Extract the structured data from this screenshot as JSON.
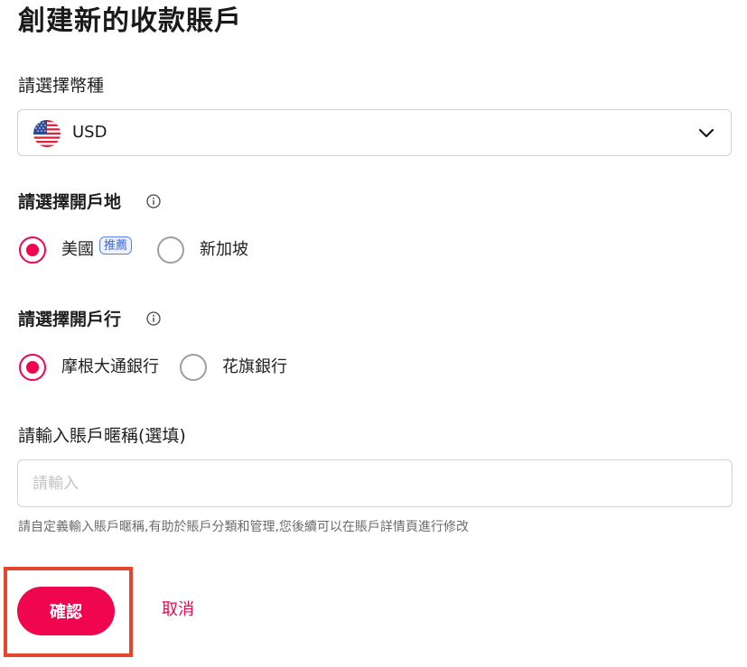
{
  "page": {
    "title": "創建新的收款賬戶"
  },
  "currency": {
    "label": "請選擇幣種",
    "selected": "USD",
    "flag_icon": "us-flag-icon"
  },
  "region": {
    "label": "請選擇開戶地",
    "options": [
      {
        "label": "美國",
        "selected": true
      },
      {
        "label": "新加坡",
        "selected": false
      }
    ],
    "badge": "推薦"
  },
  "bank": {
    "label": "請選擇開戶行",
    "options": [
      {
        "label": "摩根大通銀行",
        "selected": true
      },
      {
        "label": "花旗銀行",
        "selected": false
      }
    ]
  },
  "nickname": {
    "label": "請輸入賬戶暱稱(選填)",
    "placeholder": "請輸入",
    "value": "",
    "hint": "請自定義輸入賬戶暱稱,有助於賬戶分類和管理,您後續可以在賬戶詳情頁進行修改"
  },
  "actions": {
    "confirm": "確認",
    "cancel": "取消"
  },
  "colors": {
    "accent": "#f0054f",
    "highlight": "#e5452c",
    "badge": "#3f63d8"
  }
}
